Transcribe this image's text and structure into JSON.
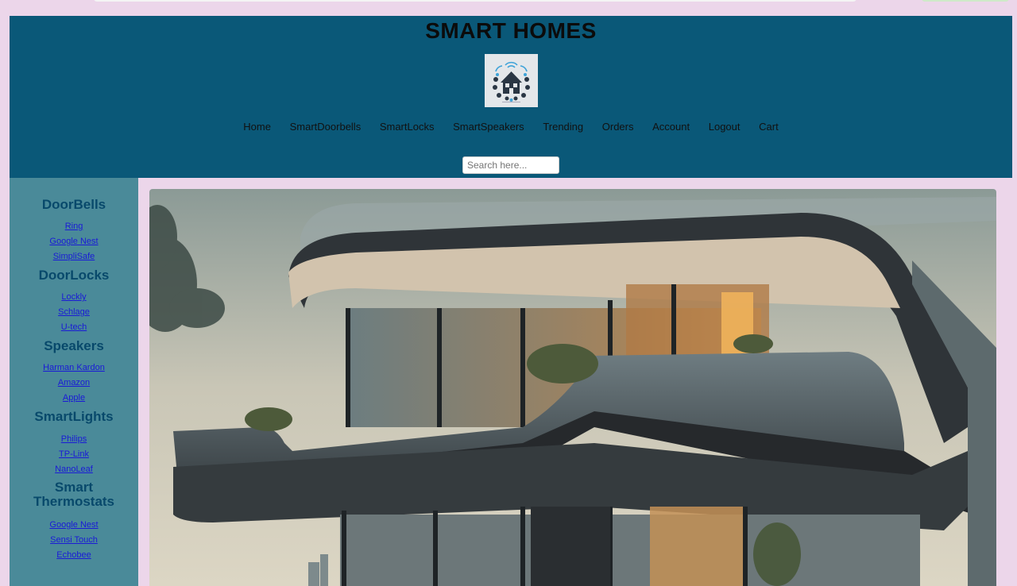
{
  "site": {
    "title": "SMART HOMES"
  },
  "nav": [
    "Home",
    "SmartDoorbells",
    "SmartLocks",
    "SmartSpeakers",
    "Trending",
    "Orders",
    "Account",
    "Logout",
    "Cart"
  ],
  "search": {
    "placeholder": "Search here..."
  },
  "sidebar": {
    "doorbells": {
      "heading": "DoorBells",
      "links": [
        "Ring",
        "Google Nest",
        "SimpliSafe"
      ]
    },
    "doorlocks": {
      "heading": "DoorLocks",
      "links": [
        "Lockly",
        "Schlage",
        "U-tech"
      ]
    },
    "speakers": {
      "heading": "Speakers",
      "links": [
        "Harman Kardon",
        "Amazon",
        "Apple"
      ]
    },
    "lights": {
      "heading": "SmartLights",
      "links": [
        "Philips",
        "TP-Link",
        "NanoLeaf"
      ]
    },
    "thermostats": {
      "heading_line1": "Smart",
      "heading_line2": "Thermostats",
      "links": [
        "Google Nest",
        "Sensi Touch",
        "Echobee"
      ]
    }
  },
  "colors": {
    "header_bg": "#0a5878",
    "sidebar_bg": "#4a8a99",
    "heading": "#08496b",
    "link": "#1a1ad6",
    "page_bg": "#ecd6ea"
  },
  "icons": {
    "logo": "smart-home-house-icon"
  }
}
